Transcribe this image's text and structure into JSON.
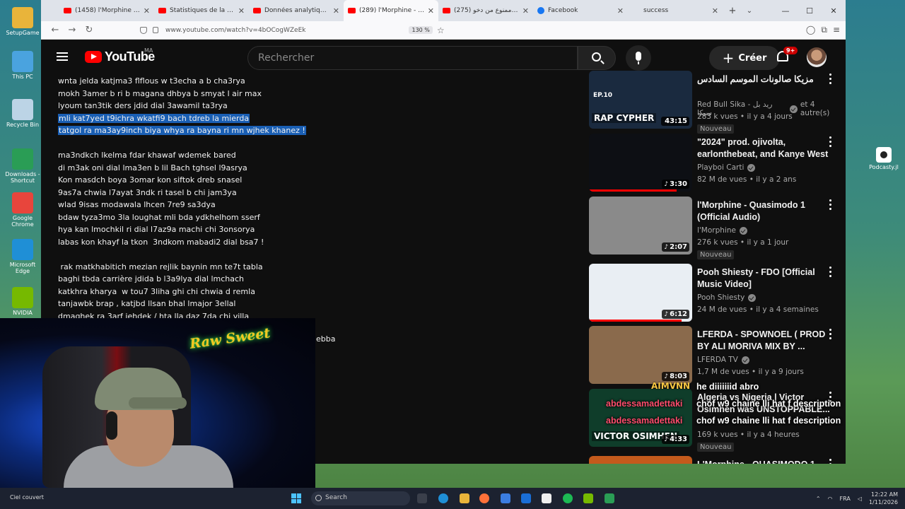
{
  "desktop": {
    "icons": [
      {
        "label": "SetupGame",
        "color": "#e9b43a"
      },
      {
        "label": "This PC",
        "color": "#4aa3df"
      },
      {
        "label": "Recycle Bin",
        "color": "#bcd4e6"
      },
      {
        "label": "Downloads - Shortcut",
        "color": "#2a9d55"
      },
      {
        "label": "Google Chrome",
        "color": "#e8453c"
      },
      {
        "label": "Microsoft Edge",
        "color": "#1f8fd6"
      },
      {
        "label": "NVIDIA",
        "color": "#76b900"
      }
    ],
    "right_icon_label": "Podcasty.jl"
  },
  "browser": {
    "tabs": [
      {
        "label": "(1458) l'Morphine - QUASI",
        "favicon": "youtube"
      },
      {
        "label": "Statistiques de la vidéo - Yo",
        "favicon": "youtube"
      },
      {
        "label": "Données analytiques de la",
        "favicon": "youtube"
      },
      {
        "label": "(289) l'Morphine - Quasim",
        "favicon": "youtube",
        "active": true
      },
      {
        "label": "(275) طوطو ممنوع من دخو",
        "favicon": "youtube"
      },
      {
        "label": "Facebook",
        "favicon": "facebook"
      },
      {
        "label": "success",
        "favicon": "none"
      }
    ],
    "url": "www.youtube.com/watch?v=4bOCogWZeEk",
    "zoom": "130 %"
  },
  "youtube": {
    "logo_text": "YouTube",
    "region": "MA",
    "search_placeholder": "Rechercher",
    "create_label": "Créer",
    "notif_badge": "9+"
  },
  "lyrics": {
    "lines": [
      {
        "text": "wnta jelda katjma3 flflous w t3echa a b cha3rya",
        "highlight": false
      },
      {
        "text": "mokh 3amer b ri b magana dhbya b smyat l air max",
        "highlight": false
      },
      {
        "text": "lyoum tan3tik ders jdid dial 3awamil ta3rya",
        "highlight": false
      },
      {
        "text": "mli kat7yed t9ichra wkatfi9 bach tdreb la mierda",
        "highlight": true
      },
      {
        "text": "tatgol ra ma3ay9inch biya whya ra bayna ri mn wjhek khanez !",
        "highlight": true
      },
      {
        "text": "",
        "highlight": false
      },
      {
        "text": "ma3ndkch lkelma fdar khawaf wdemek bared",
        "highlight": false
      },
      {
        "text": "di m3ak oni dial lma3en b lil Bach tghsel l9asrya",
        "highlight": false
      },
      {
        "text": "Kon masdch boya 3omar kon siftok dreb snasel",
        "highlight": false
      },
      {
        "text": "9as7a chwia l7ayat 3ndk ri tasel b chi jam3ya",
        "highlight": false
      },
      {
        "text": "wlad 9isas modawala lhcen 7re9 sa3dya",
        "highlight": false
      },
      {
        "text": "bdaw tyza3mo 3la loughat mli bda ydkhelhom sserf",
        "highlight": false
      },
      {
        "text": "hya kan lmochkil ri dial l7az9a machi chi 3onsorya",
        "highlight": false
      },
      {
        "text": "labas kon khayf la tkon  3ndkom mabadi2 dial bsa7 !",
        "highlight": false
      },
      {
        "text": "",
        "highlight": false
      },
      {
        "text": " rak matkhabitich mezian rejlik baynin mn te7t tabla",
        "highlight": false
      },
      {
        "text": "baghi tbda carrière jdida b l3a9lya dial lmchach",
        "highlight": false
      },
      {
        "text": "katkhra kharya  w tou7 3liha ghi chi chwia d remla",
        "highlight": false
      },
      {
        "text": "tanjawbk brap , katjbd llsan bhal lmajor 3ellal",
        "highlight": false
      },
      {
        "text": "dmaghek ra 3arf jehdek / hta lla daz 7da chi villa",
        "highlight": false
      }
    ],
    "partial_visible": "ebba"
  },
  "sidebar": {
    "videos": [
      {
        "title": "مزيكا صالونات الموسم السادس",
        "channel": "Red Bull Sika - ريد بل سيكا",
        "channel_suffix": "et 4 autre(s)",
        "meta": "283 k vues • il y a 4 jours",
        "badge": "Nouveau",
        "duration": "43:15",
        "verified": true,
        "thumb_bg": "#1a2a3f",
        "thumb_text": "RAP CYPHER",
        "thumb_tag": "EP.10",
        "progress": 0
      },
      {
        "title": "\"2024\" prod. ojivolta, earlonthebeat, and Kanye West",
        "channel": "Playboi Carti",
        "meta": "82 M de vues • il y a 2 ans",
        "badge": "",
        "duration": "3:30",
        "verified": true,
        "thumb_bg": "#0d0f14",
        "progress": 0.85
      },
      {
        "title": "l'Morphine - Quasimodo 1 (Official Audio)",
        "channel": "l'Morphine",
        "meta": "276 k vues • il y a 1 jour",
        "badge": "Nouveau",
        "duration": "2:07",
        "verified": true,
        "thumb_bg": "#8a8a8a",
        "progress": 0
      },
      {
        "title": "Pooh Shiesty - FDO [Official Music Video]",
        "channel": "Pooh Shiesty",
        "meta": "24 M de vues • il y a 4 semaines",
        "badge": "",
        "duration": "6:12",
        "verified": true,
        "thumb_bg": "#e9eef3",
        "progress": 0.9
      },
      {
        "title": "LFERDA - SPOWNOEL ( PROD BY ALI MORIVA MIX BY ...",
        "channel": "LFERDA TV",
        "meta": "1,7 M de vues • il y a 9 jours",
        "badge": "",
        "duration": "8:03",
        "verified": true,
        "thumb_bg": "#8a6a4c",
        "progress": 0
      },
      {
        "title": "Algeria vs Nigeria | Victor Osimhen was UNSTOPPABLE...",
        "channel": "",
        "meta": "169 k vues • il y a 4 heures",
        "badge": "Nouveau",
        "duration": "4:33",
        "verified": false,
        "thumb_bg": "#0f3d2a",
        "thumb_text": "VICTOR OSIMHEN",
        "progress": 0
      },
      {
        "title": "L'Morphine - QUASIMODO 1",
        "channel": "",
        "meta": "",
        "badge": "",
        "duration": "",
        "verified": false,
        "thumb_bg": "#c45a1c",
        "progress": 0
      }
    ]
  },
  "chat_overlay": {
    "sender_tag": "AIMVNN",
    "messages": [
      {
        "name": "",
        "text": "he diiiiiiid abro"
      },
      {
        "name": "abdessamadettaki",
        "text": "chof w9 chaine lli hat f description"
      },
      {
        "name": "abdessamadettaki",
        "text": "chof w9 chaine lli hat f description"
      }
    ]
  },
  "webcam": {
    "overlay_text": "Raw Sweet"
  },
  "taskbar": {
    "weather": "Ciel couvert",
    "search": "Search",
    "lang": "FRA",
    "time": "12:22 AM",
    "date": "1/11/2026"
  }
}
